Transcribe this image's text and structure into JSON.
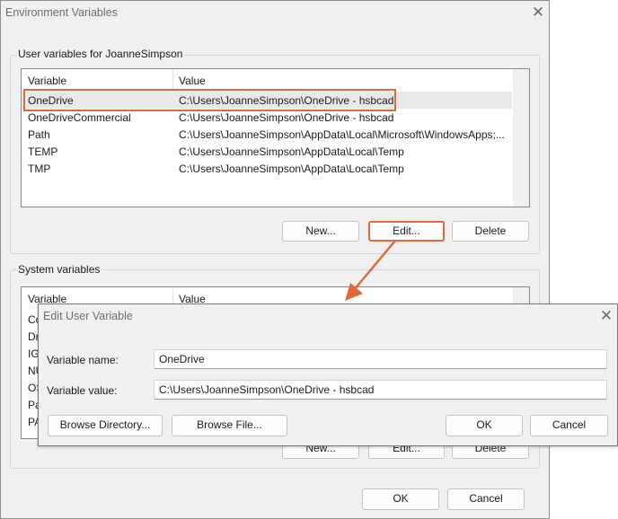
{
  "env_dialog": {
    "title": "Environment Variables",
    "user_group": {
      "label": "User variables for JoanneSimpson",
      "columns": [
        "Variable",
        "Value"
      ],
      "rows": [
        {
          "name": "OneDrive",
          "value": "C:\\Users\\JoanneSimpson\\OneDrive - hsbcad",
          "selected": true
        },
        {
          "name": "OneDriveCommercial",
          "value": "C:\\Users\\JoanneSimpson\\OneDrive - hsbcad"
        },
        {
          "name": "Path",
          "value": "C:\\Users\\JoanneSimpson\\AppData\\Local\\Microsoft\\WindowsApps;..."
        },
        {
          "name": "TEMP",
          "value": "C:\\Users\\JoanneSimpson\\AppData\\Local\\Temp"
        },
        {
          "name": "TMP",
          "value": "C:\\Users\\JoanneSimpson\\AppData\\Local\\Temp"
        }
      ],
      "buttons": {
        "new": "New...",
        "edit": "Edit...",
        "delete": "Delete"
      }
    },
    "system_group": {
      "label": "System variables",
      "columns": [
        "Variable",
        "Value"
      ],
      "visible_row_prefixes": [
        "Co",
        "Dr",
        "IG",
        "NU",
        "OS",
        "Pa",
        "PA"
      ],
      "buttons": {
        "new": "New...",
        "edit": "Edit...",
        "delete": "Delete"
      }
    },
    "ok": "OK",
    "cancel": "Cancel"
  },
  "edit_dialog": {
    "title": "Edit User Variable",
    "name_label": "Variable name:",
    "name_value": "OneDrive",
    "value_label": "Variable value:",
    "value_value": "C:\\Users\\JoanneSimpson\\OneDrive - hsbcad",
    "browse_directory": "Browse Directory...",
    "browse_file": "Browse File...",
    "ok": "OK",
    "cancel": "Cancel"
  },
  "colors": {
    "highlight": "#e0693a",
    "window_bg": "#f0f0f0"
  },
  "icons": {
    "close": "close-icon",
    "arrow": "arrow-icon"
  }
}
